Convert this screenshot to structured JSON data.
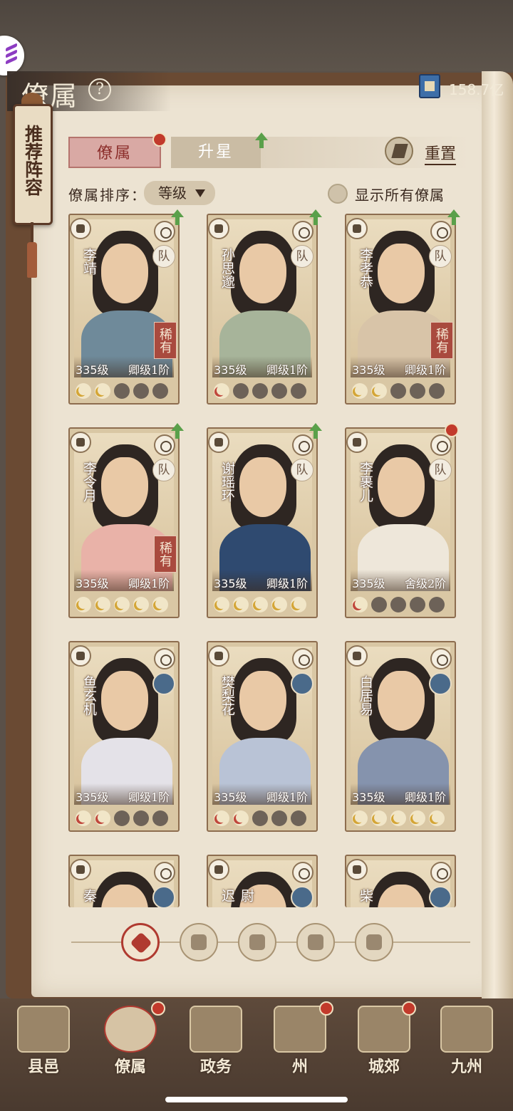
{
  "header": {
    "title": "僚属",
    "currency_amount": "158.7亿"
  },
  "banner": {
    "label": "推荐阵容"
  },
  "tabs": [
    {
      "label": "僚属",
      "active": true,
      "badge": true
    },
    {
      "label": "升星",
      "active": false,
      "upgrade": true
    }
  ],
  "reset_label": "重置",
  "sort": {
    "label": "僚属排序：",
    "value": "等级"
  },
  "show_all_label": "显示所有僚属",
  "cards": [
    {
      "name": "李靖",
      "level": "335级",
      "rank": "卿级1阶",
      "rare": "稀有",
      "team": "队",
      "upgrade": true,
      "badge": false,
      "stars": [
        "gold",
        "gold",
        "empty",
        "empty",
        "empty"
      ],
      "robe": "#6f8a9a"
    },
    {
      "name": "孙思邈",
      "level": "335级",
      "rank": "卿级1阶",
      "rare": "",
      "team": "队",
      "upgrade": true,
      "badge": false,
      "stars": [
        "red",
        "empty",
        "empty",
        "empty",
        "empty"
      ],
      "robe": "#a7b49a"
    },
    {
      "name": "李孝恭",
      "level": "335级",
      "rank": "卿级1阶",
      "rare": "稀有",
      "team": "队",
      "upgrade": true,
      "badge": false,
      "stars": [
        "gold",
        "gold",
        "empty",
        "empty",
        "empty"
      ],
      "robe": "#d8c4a8"
    },
    {
      "name": "李令月",
      "level": "335级",
      "rank": "卿级1阶",
      "rare": "稀有",
      "team": "队",
      "upgrade": true,
      "badge": false,
      "stars": [
        "gold",
        "gold",
        "gold",
        "gold",
        "gold"
      ],
      "robe": "#e9b2a8"
    },
    {
      "name": "谢瑶环",
      "level": "335级",
      "rank": "卿级1阶",
      "rare": "",
      "team": "队",
      "upgrade": true,
      "badge": false,
      "stars": [
        "gold",
        "gold",
        "gold",
        "gold",
        "gold"
      ],
      "robe": "#2f4a70"
    },
    {
      "name": "李裹儿",
      "level": "335级",
      "rank": "舍级2阶",
      "rare": "",
      "team": "队",
      "upgrade": false,
      "badge": true,
      "stars": [
        "red",
        "empty",
        "empty",
        "empty",
        "empty"
      ],
      "robe": "#eee7da"
    },
    {
      "name": "鱼玄机",
      "level": "335级",
      "rank": "卿级1阶",
      "rare": "",
      "team": "",
      "upgrade": false,
      "badge": false,
      "stars": [
        "red",
        "red",
        "empty",
        "empty",
        "empty"
      ],
      "robe": "#e4e2e8"
    },
    {
      "name": "樊梨花",
      "level": "335级",
      "rank": "卿级1阶",
      "rare": "",
      "team": "",
      "upgrade": false,
      "badge": false,
      "stars": [
        "red",
        "red",
        "empty",
        "empty",
        "empty"
      ],
      "robe": "#b9c3d6"
    },
    {
      "name": "白居易",
      "level": "335级",
      "rank": "卿级1阶",
      "rare": "",
      "team": "",
      "upgrade": false,
      "badge": false,
      "stars": [
        "gold",
        "gold",
        "gold",
        "gold",
        "gold"
      ],
      "robe": "#8593ad"
    },
    {
      "name": "秦",
      "level": "",
      "rank": "",
      "rare": "",
      "team": "",
      "upgrade": false,
      "badge": false,
      "stars": [],
      "robe": "#e0d4bc"
    },
    {
      "name": "尉迟",
      "level": "",
      "rank": "",
      "rare": "",
      "team": "",
      "upgrade": false,
      "badge": false,
      "stars": [],
      "robe": "#e0d4bc"
    },
    {
      "name": "柴",
      "level": "",
      "rank": "",
      "rare": "",
      "team": "",
      "upgrade": false,
      "badge": false,
      "stars": [],
      "robe": "#e0d4bc"
    }
  ],
  "categories": [
    {
      "icon": "all-category-icon",
      "active": true
    },
    {
      "icon": "strength-category-icon",
      "active": false
    },
    {
      "icon": "wisdom-category-icon",
      "active": false
    },
    {
      "icon": "charm-category-icon",
      "active": false
    },
    {
      "icon": "politics-category-icon",
      "active": false
    }
  ],
  "nav": [
    {
      "label": "县邑",
      "active": false,
      "badge": false
    },
    {
      "label": "僚属",
      "active": true,
      "badge": true
    },
    {
      "label": "政务",
      "active": false,
      "badge": false
    },
    {
      "label": "州",
      "active": false,
      "badge": true
    },
    {
      "label": "城郊",
      "active": false,
      "badge": true
    },
    {
      "label": "九州",
      "active": false,
      "badge": false
    }
  ],
  "colors": {
    "accent_red": "#b03a30",
    "paper": "#ece3d2",
    "wood": "#6a4a33"
  }
}
